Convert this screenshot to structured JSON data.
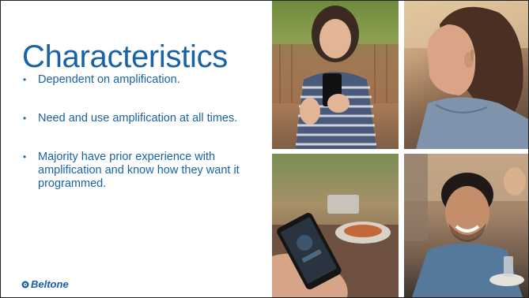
{
  "slide": {
    "title": "Characteristics",
    "bullets": [
      "Dependent on amplification.",
      "Need and use amplification at all times.",
      "Majority have prior experience with amplification and know how they want it programmed."
    ],
    "logo_text": "Beltone"
  },
  "photos": [
    {
      "name": "woman-waving-at-phone-photo"
    },
    {
      "name": "woman-wearing-hearing-aid-photo"
    },
    {
      "name": "hand-holding-phone-app-photo"
    },
    {
      "name": "smiling-man-at-dinner-photo"
    }
  ],
  "colors": {
    "title": "#1a62a6",
    "text": "#1a62a6",
    "logo": "#1b5ea8"
  }
}
